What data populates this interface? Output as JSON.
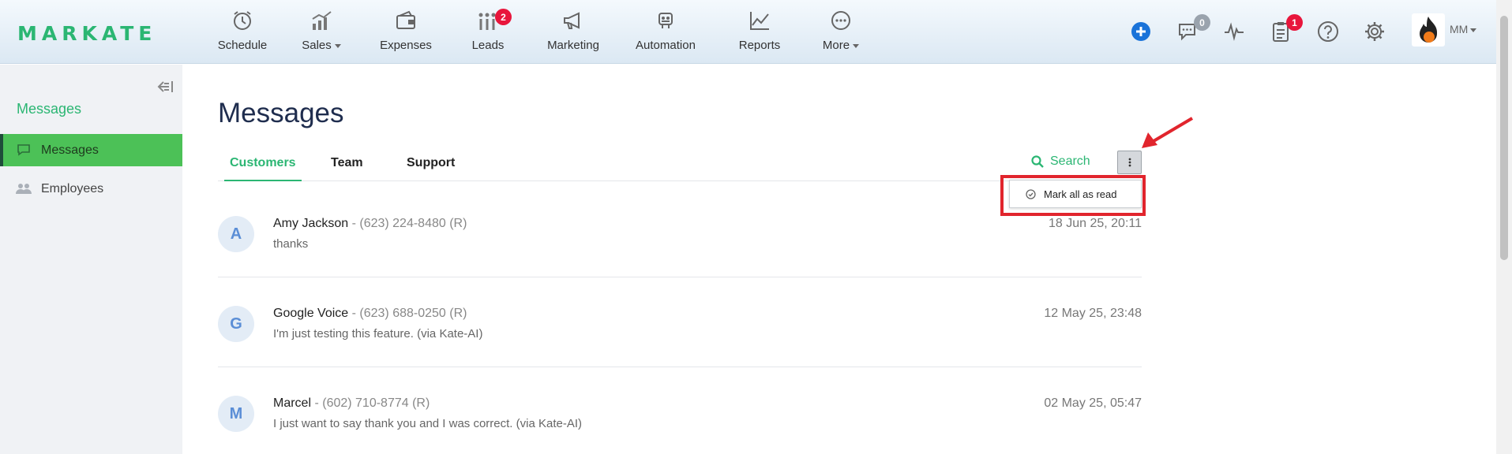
{
  "brand": {
    "logo_text": "MARKATE",
    "accent": "#2bb673"
  },
  "nav": {
    "items": [
      {
        "label": "Schedule",
        "icon": "alarm-clock-icon"
      },
      {
        "label": "Sales",
        "icon": "sales-chart-icon",
        "has_dropdown": true
      },
      {
        "label": "Expenses",
        "icon": "wallet-icon"
      },
      {
        "label": "Leads",
        "icon": "leads-bars-icon",
        "badge": "2"
      },
      {
        "label": "Marketing",
        "icon": "megaphone-icon"
      },
      {
        "label": "Automation",
        "icon": "robot-icon"
      },
      {
        "label": "Reports",
        "icon": "line-chart-icon"
      },
      {
        "label": "More",
        "icon": "more-dots-icon",
        "has_dropdown": true
      }
    ],
    "right": {
      "add_icon": "plus-circle-icon",
      "chat_badge": "0",
      "activity_icon": "pulse-icon",
      "tasks_badge": "1",
      "help_icon": "help-circle-icon",
      "settings_icon": "gear-icon",
      "user_initials": "MM"
    }
  },
  "sidebar": {
    "title": "Messages",
    "items": [
      {
        "label": "Messages",
        "icon": "chat-bubble-icon",
        "active": true
      },
      {
        "label": "Employees",
        "icon": "users-icon",
        "active": false
      }
    ]
  },
  "main": {
    "title": "Messages",
    "tabs": [
      {
        "label": "Customers",
        "active": true
      },
      {
        "label": "Team",
        "active": false
      },
      {
        "label": "Support",
        "active": false
      }
    ],
    "search_label": "Search",
    "dropdown": {
      "item_label": "Mark all as read",
      "item_icon": "check-circle-icon"
    },
    "messages": [
      {
        "initial": "A",
        "name": "Amy Jackson",
        "phone": " - (623) 224-8480 (R)",
        "preview": "thanks",
        "date": "18 Jun 25, 20:11"
      },
      {
        "initial": "G",
        "name": "Google Voice",
        "phone": " - (623) 688-0250 (R)",
        "preview": "I'm just testing this feature. (via Kate-AI)",
        "date": "12 May 25, 23:48"
      },
      {
        "initial": "M",
        "name": "Marcel",
        "phone": " - (602) 710-8774 (R)",
        "preview": "I just want to say thank you and I was correct. (via Kate-AI)",
        "date": "02 May 25, 05:47"
      }
    ]
  },
  "colors": {
    "badge_red": "#e8163c",
    "annotation_red": "#e1252d",
    "active_green": "#4cc157",
    "title_navy": "#1f2d4e"
  }
}
